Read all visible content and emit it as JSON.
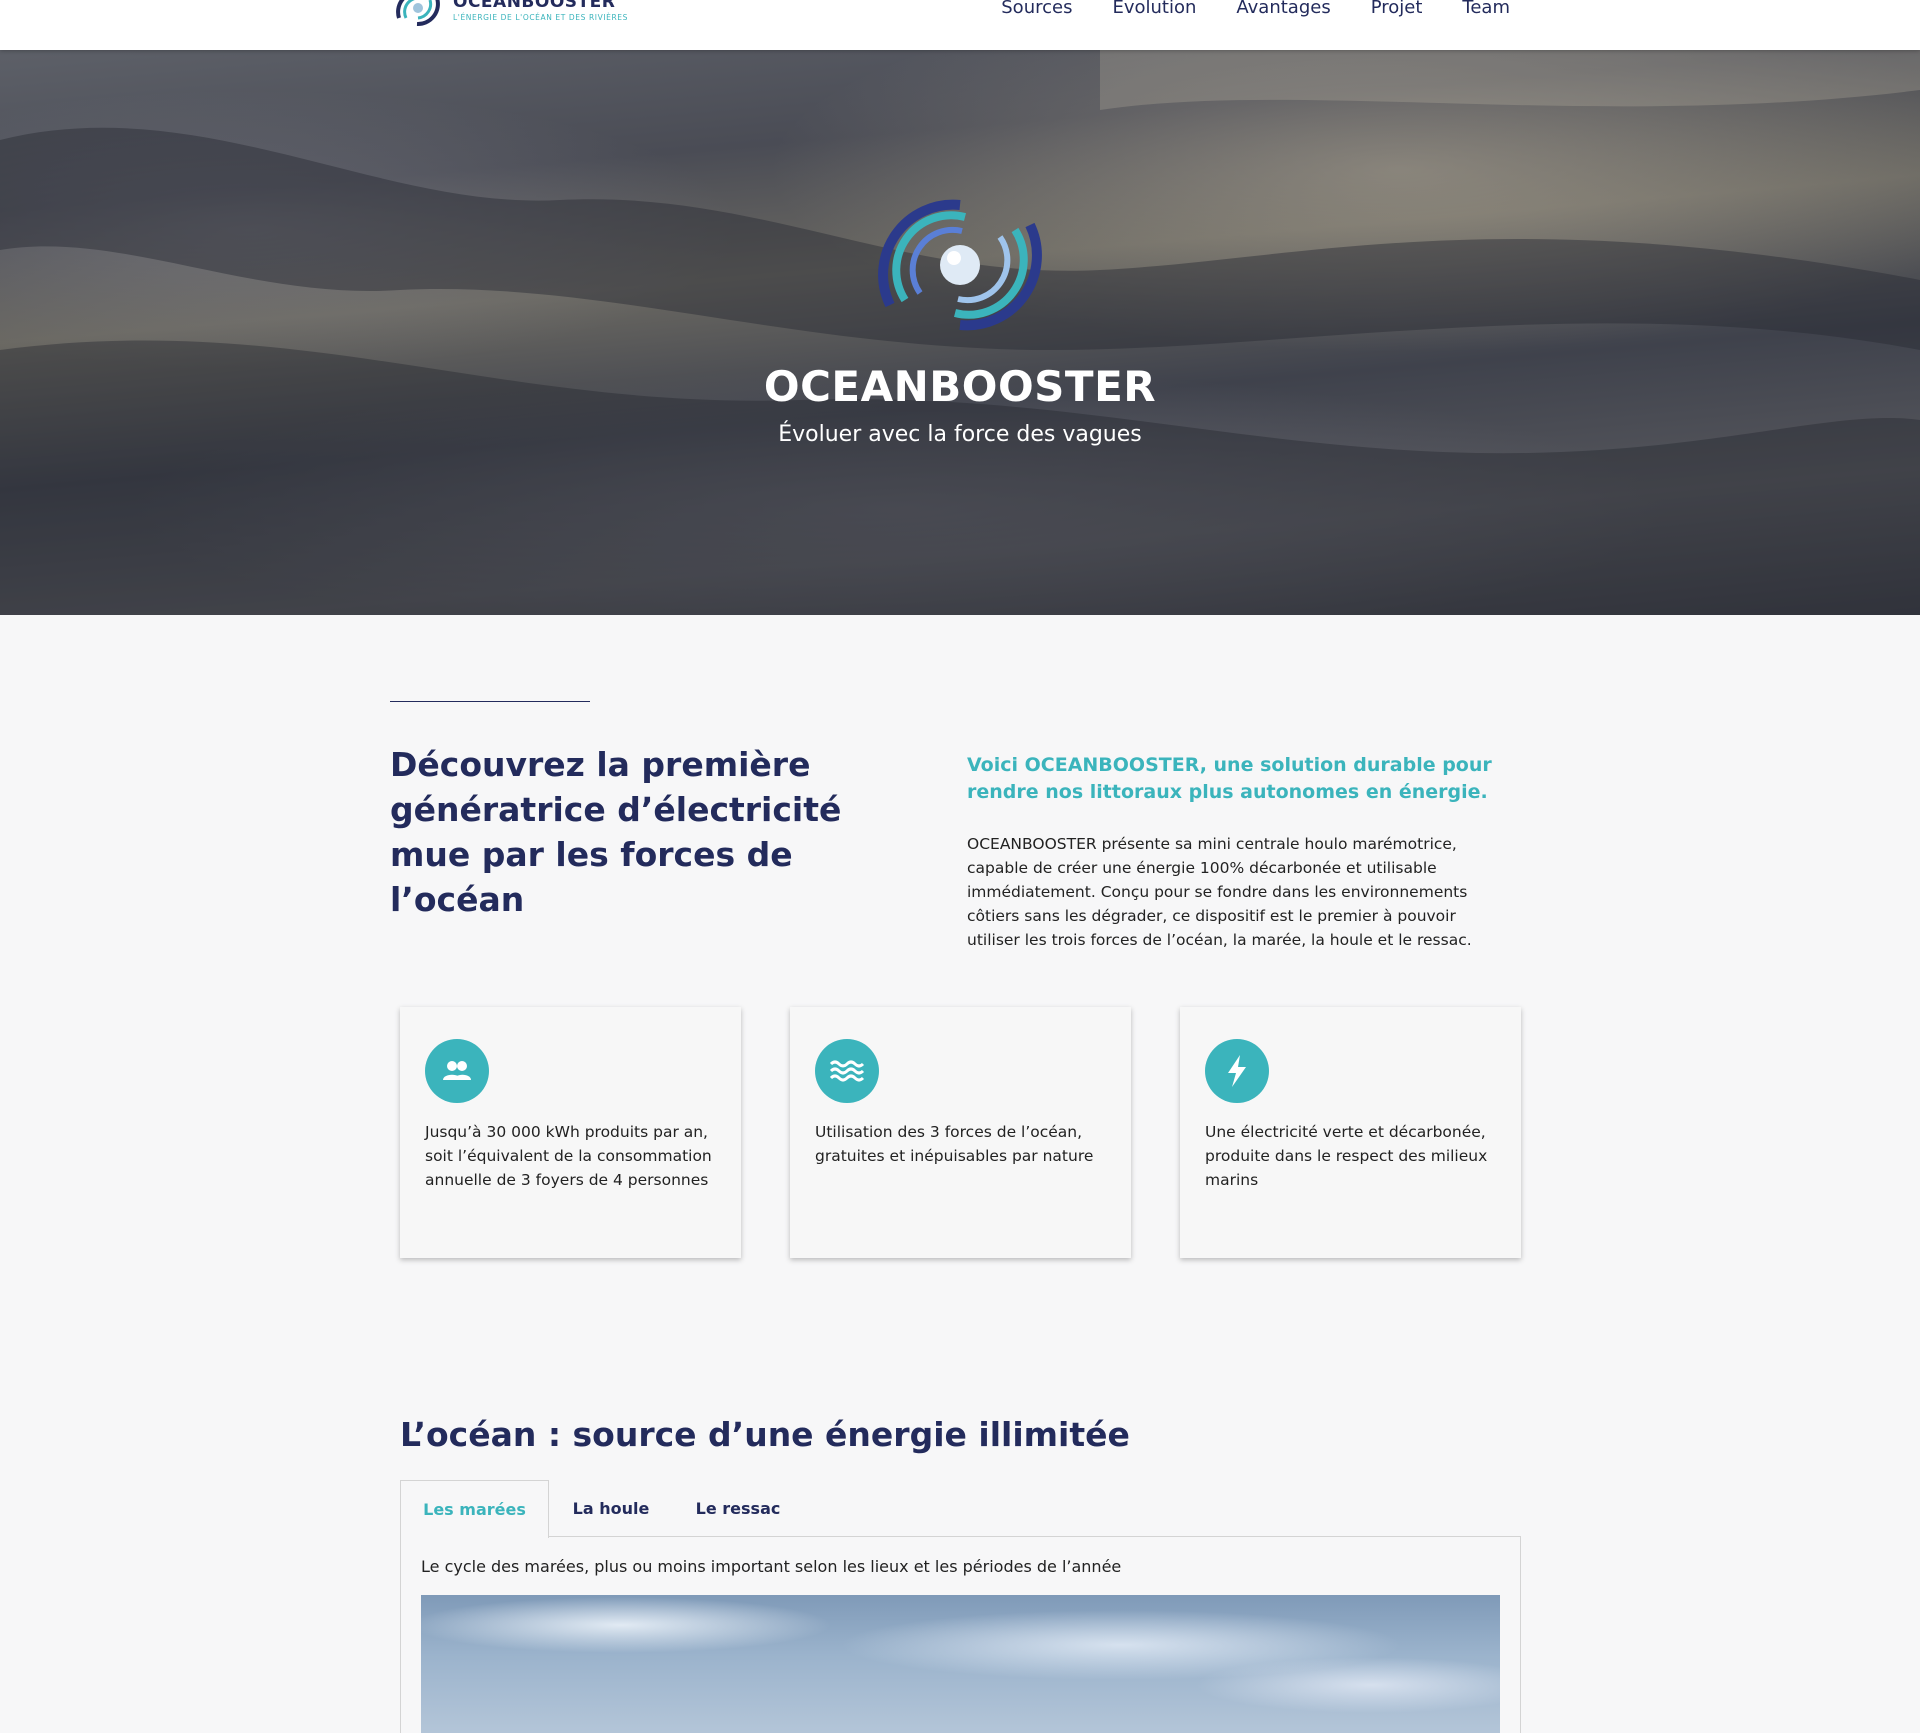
{
  "nav": {
    "brand_name": "OCEANBOOSTER",
    "brand_tagline": "L'ÉNERGIE DE L'OCÉAN ET DES RIVIÈRES",
    "links": [
      {
        "label": "Sources"
      },
      {
        "label": "Evolution"
      },
      {
        "label": "Avantages"
      },
      {
        "label": "Projet"
      },
      {
        "label": "Team"
      }
    ]
  },
  "hero": {
    "title": "OCEANBOOSTER",
    "subtitle": "Évoluer avec la force des vagues"
  },
  "intro": {
    "heading": "Découvrez la première génératrice d’électricité mue par les forces de l’océan",
    "lead": "Voici OCEANBOOSTER, une solution durable pour rendre nos littoraux plus autonomes en énergie.",
    "body": "OCEANBOOSTER présente sa mini centrale houlo marémotrice, capable de créer une énergie 100% décarbonée et utilisable immédiatement. Conçu pour se fondre dans les environnements côtiers sans les dégrader, ce dispositif est le premier à pouvoir utiliser les trois forces de l’océan, la marée, la houle et le ressac."
  },
  "cards": [
    {
      "icon": "people-icon",
      "text": "Jusqu’à 30 000 kWh produits par an, soit l’équivalent de la consommation annuelle de 3 foyers de 4 personnes"
    },
    {
      "icon": "water-waves-icon",
      "text": "Utilisation des 3 forces de l’océan, gratuites et inépuisables par nature"
    },
    {
      "icon": "lightning-bolt-icon",
      "text": "Une électricité verte et décarbonée, produite dans le respect des milieux marins"
    }
  ],
  "sources": {
    "heading": "L’océan : source d’une énergie illimitée",
    "tabs": [
      {
        "label": "Les marées"
      },
      {
        "label": "La houle"
      },
      {
        "label": "Le ressac"
      }
    ],
    "active_tab": "Les marées",
    "caption": "Le cycle des marées, plus ou moins important selon les lieux et les périodes de l’année"
  },
  "colors": {
    "navy": "#232b5c",
    "teal": "#3bb4bc"
  }
}
